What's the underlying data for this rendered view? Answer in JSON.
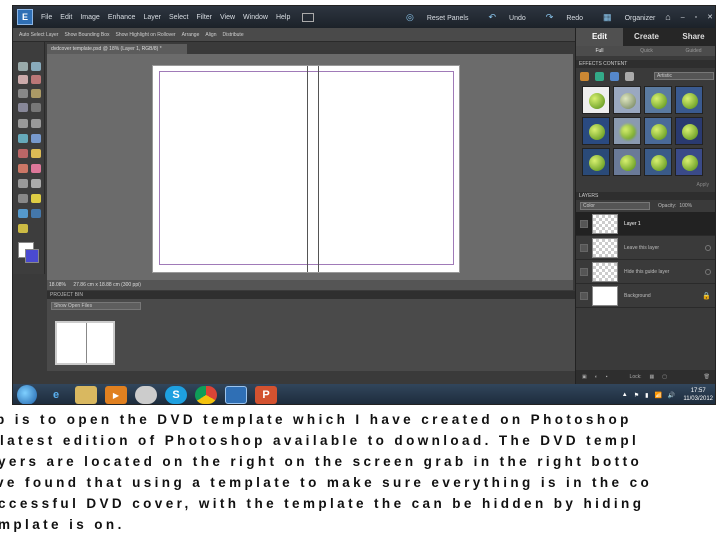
{
  "menubar": {
    "items": [
      "File",
      "Edit",
      "Image",
      "Enhance",
      "Layer",
      "Select",
      "Filter",
      "View",
      "Window",
      "Help"
    ],
    "right": [
      "Reset Panels",
      "Undo",
      "Redo",
      "Organizer"
    ]
  },
  "options_bar": {
    "items": [
      "Auto Select Layer",
      "Show Bounding Box",
      "Show Highlight on Rollover",
      "Arrange",
      "Align",
      "Distribute"
    ]
  },
  "document_tab": "dvdcover template.psd @ 18% (Layer 1, RGB/8) *",
  "status_bar": {
    "zoom": "18.08%",
    "size": "27.86 cm x 18.88 cm (300 ppi)"
  },
  "project_bin": {
    "title": "PROJECT BIN",
    "dropdown": "Show Open Files"
  },
  "right_panel": {
    "tabs": [
      "Edit",
      "Create",
      "Share"
    ],
    "subtabs": [
      "Full",
      "Quick",
      "Guided"
    ],
    "effects_header": "EFFECTS  CONTENT",
    "effects_dropdown": "Artistic",
    "apply_button": "Apply",
    "layers_header": "LAYERS",
    "blend_mode": "Color",
    "opacity_label": "Opacity:",
    "opacity_value": "100%",
    "layers": [
      {
        "name": "Layer 1"
      },
      {
        "name": "Leave this layer"
      },
      {
        "name": "Hide this guide layer"
      },
      {
        "name": "Background"
      }
    ],
    "lock_label": "Lock:"
  },
  "taskbar": {
    "time": "17:57",
    "date": "11/03/2012"
  },
  "caption": {
    "lines": [
      "p is to open the DVD template which I have created on Photoshop",
      "latest edition of Photoshop available to download. The DVD templ",
      "yers are located on the right on the screen grab in the right botto",
      "ve found that using a template to make sure everything is in the co",
      "ccessful DVD cover, with the template the can be hidden by hiding",
      "mplate is on."
    ]
  }
}
